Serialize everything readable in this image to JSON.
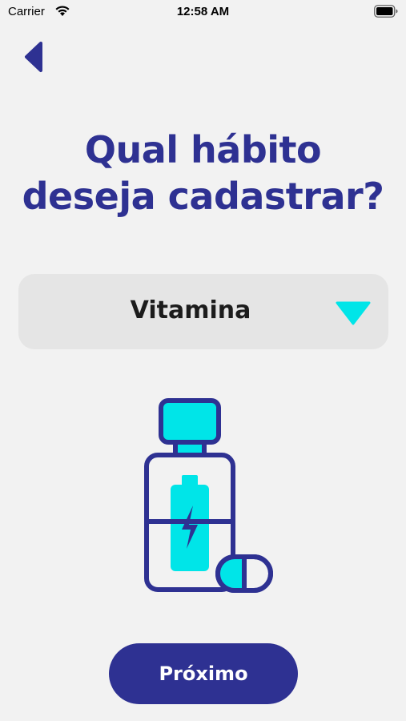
{
  "status_bar": {
    "carrier": "Carrier",
    "time": "12:58 AM",
    "wifi_icon": "wifi-icon",
    "battery_icon": "battery-icon"
  },
  "nav": {
    "back_icon": "back-arrow-icon"
  },
  "title": {
    "line1": "Qual hábito",
    "line2": "deseja cadastrar?"
  },
  "habit_select": {
    "selected_value": "Vitamina",
    "arrow_icon": "chevron-down-icon"
  },
  "illustration": {
    "icon": "vitamin-bottle-icon"
  },
  "next_button": {
    "label": "Próximo"
  },
  "colors": {
    "primary": "#2e3192",
    "accent": "#00e5e8",
    "background": "#f2f2f2",
    "select_background": "#e5e5e5"
  }
}
